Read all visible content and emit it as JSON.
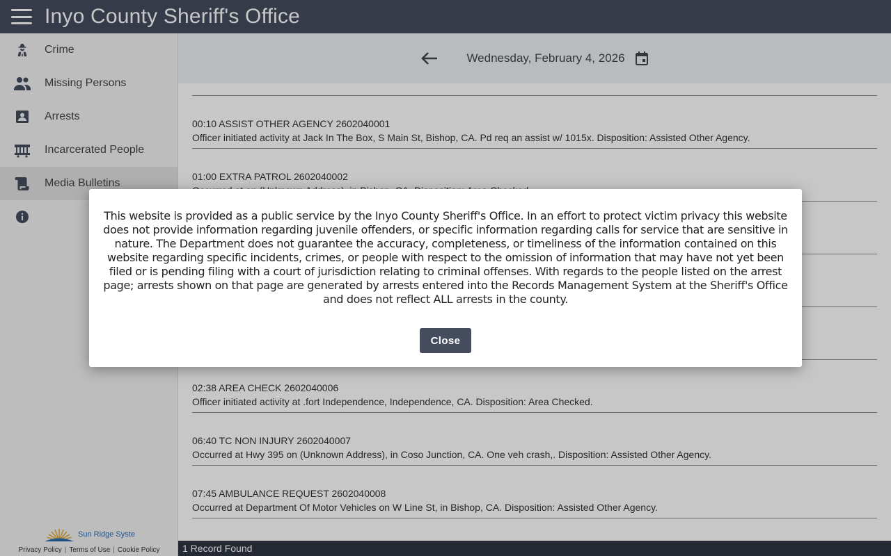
{
  "header": {
    "title": "Inyo County Sheriff's Office"
  },
  "sidebar": {
    "items": [
      {
        "label": "Crime",
        "icon": "detective-icon"
      },
      {
        "label": "Missing Persons",
        "icon": "people-icon"
      },
      {
        "label": "Arrests",
        "icon": "contact-card-icon"
      },
      {
        "label": "Incarcerated People",
        "icon": "jail-icon"
      },
      {
        "label": "Media Bulletins",
        "icon": "scroll-icon",
        "active": true
      },
      {
        "label": "",
        "icon": "info-icon"
      }
    ],
    "brand": "Sun Ridge Syste",
    "footer_links": [
      "Privacy Policy",
      "Terms of Use",
      "Cookie Policy"
    ]
  },
  "datebar": {
    "date": "Wednesday, February 4, 2026"
  },
  "entries": [
    {
      "title": "00:10 ASSIST OTHER AGENCY 2602040001",
      "desc": "Officer initiated activity at Jack In The Box, S Main St, Bishop, CA. Pd req an assist w/ 1015x. Disposition: Assisted Other Agency."
    },
    {
      "title": "01:00 EXTRA PATROL 2602040002",
      "desc": "Occurred at on (Unknown Address), in Bishop, CA. Disposition: Area Checked."
    },
    {
      "title": "",
      "desc": ""
    },
    {
      "title": "",
      "desc": ""
    },
    {
      "title": "",
      "desc": ""
    },
    {
      "title": "02:38 AREA CHECK 2602040006",
      "desc": "Officer initiated activity at .fort Independence, Independence, CA. Disposition: Area Checked."
    },
    {
      "title": "06:40 TC NON INJURY 2602040007",
      "desc": "Occurred at Hwy 395 on (Unknown Address), in Coso Junction, CA. One veh crash,. Disposition: Assisted Other Agency."
    },
    {
      "title": "07:45 AMBULANCE REQUEST 2602040008",
      "desc": "Occurred at Department Of Motor Vehicles on W Line St, in Bishop, CA. Disposition: Assisted Other Agency."
    }
  ],
  "status": {
    "text": "1 Record Found"
  },
  "modal": {
    "text": "This website is provided as a public service by the Inyo County Sheriff's Office. In an effort to protect victim privacy this website does not provide information regarding juvenile offenders, or specific information regarding calls for service that are sensitive in nature. The Department does not guarantee the accuracy, completeness, or timeliness of the information contained on this website regarding specific incidents, crimes, or people with respect to the omission of information that may have not yet been filed or is pending filing with a court of jurisdiction relating to criminal offenses. With regards to the people listed on the arrest page; arrests shown on that page are generated by arrests entered into the Records Management System at the Sheriff's Office and does not reflect ALL arrests in the county.",
    "close_label": "Close"
  },
  "colors": {
    "header": "#454c5e",
    "status_bar": "#2f3542",
    "brand": "#2a6cb0"
  }
}
